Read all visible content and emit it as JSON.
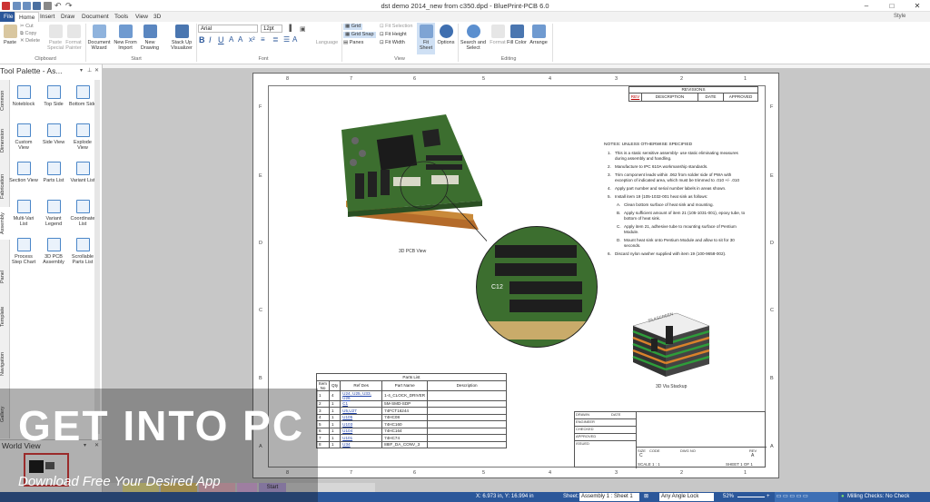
{
  "titlebar": {
    "title": "dst demo 2014_new from c350.dpd - BluePrint-PCB 6.0"
  },
  "menu": {
    "tabs": [
      "File",
      "Home",
      "Insert",
      "Draw",
      "Document",
      "Tools",
      "View",
      "3D"
    ],
    "style": "Style"
  },
  "ribbon": {
    "clipboard": {
      "paste": "Paste",
      "cut": "Cut",
      "copy": "Copy",
      "delete": "Delete",
      "paste_special": "Paste Special",
      "format_painter": "Format Painter",
      "label": "Clipboard"
    },
    "start": {
      "doc_wizard": "Document Wizard",
      "new_from_import": "New From Import",
      "new_drawing": "New Drawing",
      "stackup": "Stack Up Visualizer",
      "label": "Start"
    },
    "font": {
      "name": "Arial",
      "size": "12pt",
      "b": "B",
      "i": "I",
      "u": "U",
      "label": "Font"
    },
    "language": "Language",
    "view": {
      "grid": "Grid",
      "fit_selection": "Fit Selection",
      "grid_snap": "Grid Snap",
      "fit_height": "Fit Height",
      "panes": "Panes",
      "fit_width": "Fit Width",
      "fit_sheet": "Fit Sheet",
      "options": "Options",
      "label": "View"
    },
    "editing": {
      "search": "Search and Select",
      "format": "Format",
      "fill_color": "Fill Color",
      "arrange": "Arrange",
      "label": "Editing"
    }
  },
  "palette": {
    "title": "Tool Palette - As...",
    "tabs": [
      "Common",
      "Dimension",
      "Fabrication",
      "Assembly",
      "Panel",
      "Template",
      "Navigation",
      "Gallery"
    ],
    "tools": [
      "Noteblock",
      "Top Side",
      "Bottom Side",
      "Custom View",
      "Side View",
      "Explode View",
      "Section View",
      "Parts List",
      "Variant List",
      "Multi-Vari List",
      "Variant Legend",
      "Coordinate List",
      "Process Step Chart",
      "3D PCB Assembly",
      "Scrollable Parts List"
    ]
  },
  "world_view": {
    "title": "World View"
  },
  "sheet": {
    "zones_top": [
      "8",
      "7",
      "6",
      "5",
      "4",
      "3",
      "2",
      "1"
    ],
    "zones_side": [
      "F",
      "E",
      "D",
      "C",
      "B",
      "A"
    ],
    "revisions": {
      "title": "REVISIONS",
      "headers": [
        "REV",
        "DESCRIPTION",
        "DATE",
        "APPROVED"
      ]
    },
    "notes_title": "NOTES: UNLESS OTHERWISE SPECIFIED",
    "notes": [
      {
        "n": "1.",
        "t": "This is a static sensitive assembly- use static eliminating measures during assembly and handling."
      },
      {
        "n": "2.",
        "t": "Manufacture to IPC 610A workmanship standards."
      },
      {
        "n": "3.",
        "t": "Trim component leads within .062 from solder side of PWA with exception of indicated area, which must be trimmed to .010 +/- .010"
      },
      {
        "n": "4.",
        "t": "Apply part number and serial number labels in areas shown."
      },
      {
        "n": "5.",
        "t": "Install item 19 (105-1032-001 heat sink as follows:"
      },
      {
        "n": "A.",
        "t": "Clean bottom surface of heat sink and mounting."
      },
      {
        "n": "B.",
        "t": "Apply sufficient amount of item 21 (105-1031-001), epoxy tube, to bottom of heat sink."
      },
      {
        "n": "C.",
        "t": "Apply item 21, adhesive tube to mounting surface of Pentium Module."
      },
      {
        "n": "D.",
        "t": "Mount heat sink onto Pentium Module and allow to sit for 30 seconds."
      },
      {
        "n": "6.",
        "t": "Discard nylon washer supplied with item 19 (100-9658-002)."
      }
    ],
    "pcb_label": "3D PCB View",
    "zoom_label": "C12",
    "stack_label": "3D Via Stackup",
    "stack_top_text": "SILKSCREEN",
    "parts_list": {
      "title": "Parts List",
      "headers": [
        "Item No",
        "Qty",
        "Ref Des",
        "Part Name",
        "Description"
      ],
      "rows": [
        {
          "item": "1",
          "qty": "4",
          "ref": "U24, U25, U33, U26",
          "part": "1-4_CLOCK_DRIVER",
          "desc": ""
        },
        {
          "item": "2",
          "qty": "1",
          "ref": "C1",
          "part": "5M-SMD-SDP",
          "desc": ""
        },
        {
          "item": "3",
          "qty": "1",
          "ref": "U5,U27",
          "part": "74FCT16244",
          "desc": ""
        },
        {
          "item": "4",
          "qty": "1",
          "ref": "U105",
          "part": "74HC08",
          "desc": ""
        },
        {
          "item": "5",
          "qty": "1",
          "ref": "U103",
          "part": "74HC160",
          "desc": ""
        },
        {
          "item": "6",
          "qty": "1",
          "ref": "U104",
          "part": "74HC164",
          "desc": ""
        },
        {
          "item": "7",
          "qty": "1",
          "ref": "U101",
          "part": "74HC74",
          "desc": ""
        },
        {
          "item": "8",
          "qty": "1",
          "ref": "U34",
          "part": "88IF_DA_CONV_3",
          "desc": ""
        }
      ]
    },
    "title_block": {
      "drawn": "DRAWN",
      "checked": "CHECKED",
      "engineer": "ENGINEER",
      "approved": "APPROVED",
      "issued": "ISSUED",
      "size": "SIZE",
      "size_val": "C",
      "code": "CODE",
      "dwg": "DWG NO",
      "rev": "REV",
      "rev_val": "A",
      "scale": "SCALE 1 : 1",
      "sheet": "SHEET 1 OF 1",
      "date": "DATE"
    }
  },
  "bottom_tabs": [
    "Start"
  ],
  "status": {
    "coords": "X: 6.973 in, Y: 16.994 in",
    "sheet": "Sheet:",
    "sheet_val": "Assembly 1 : Sheet 1",
    "angle": "Any Angle Lock",
    "zoom": "52%",
    "milling": "Milling Checks: No Check"
  },
  "watermark": {
    "title": "GET INTO PC",
    "sub": "Download Free Your Desired App"
  },
  "colors": {
    "accent": "#2b579a",
    "pcb_green": "#3c6e2f",
    "copper": "#c98a3a",
    "canvas": "#c7c7c7"
  }
}
